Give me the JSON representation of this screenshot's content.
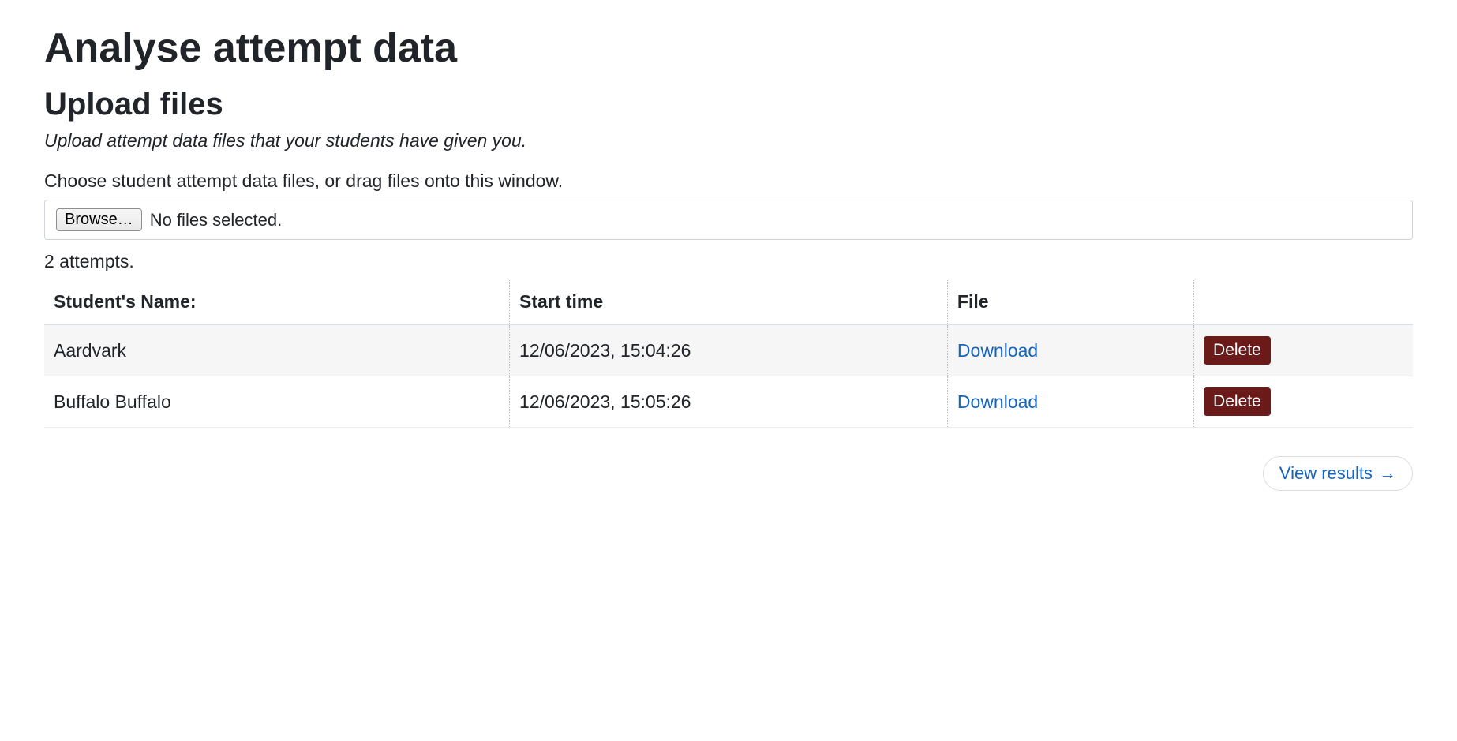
{
  "page": {
    "title": "Analyse attempt data"
  },
  "upload": {
    "heading": "Upload files",
    "subtext": "Upload attempt data files that your students have given you.",
    "instructions": "Choose student attempt data files, or drag files onto this window.",
    "browse_label": "Browse…",
    "file_status": "No files selected."
  },
  "attempts": {
    "count_text": "2 attempts.",
    "headers": {
      "name": "Student's Name:",
      "start": "Start time",
      "file": "File",
      "action": ""
    },
    "download_label": "Download",
    "delete_label": "Delete",
    "rows": [
      {
        "name": "Aardvark",
        "start": "12/06/2023, 15:04:26"
      },
      {
        "name": "Buffalo Buffalo",
        "start": "12/06/2023, 15:05:26"
      }
    ]
  },
  "footer": {
    "view_results_label": "View results",
    "arrow": "→"
  }
}
